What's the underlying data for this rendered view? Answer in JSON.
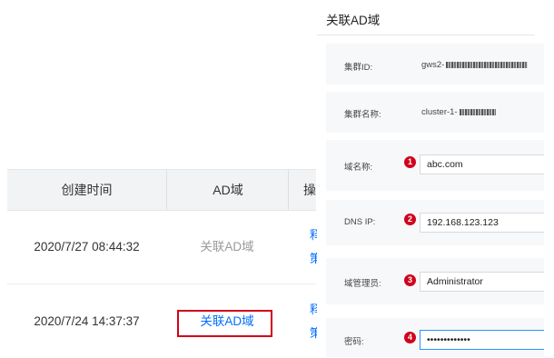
{
  "table": {
    "columns": [
      "创建时间",
      "AD域",
      "操"
    ],
    "rows": [
      {
        "created": "2020/7/27 08:44:32",
        "ad_action": "关联AD域",
        "ad_state": "disabled",
        "op_line1": "释",
        "op_line2": "策"
      },
      {
        "created": "2020/7/24 14:37:37",
        "ad_action": "关联AD域",
        "ad_state": "active",
        "op_line1": "释",
        "op_line2": "策"
      }
    ]
  },
  "modal": {
    "title": "关联AD域",
    "cluster_id": {
      "label": "集群ID:",
      "value_prefix": "gws2-"
    },
    "cluster_name": {
      "label": "集群名称:",
      "value_prefix": "cluster-1-"
    },
    "domain_name": {
      "label": "域名称:",
      "step": "1",
      "value": "abc.com"
    },
    "dns_ip": {
      "label": "DNS IP:",
      "step": "2",
      "value": "192.168.123.123"
    },
    "domain_admin": {
      "label": "域管理员:",
      "step": "3",
      "value": "Administrator"
    },
    "password": {
      "label": "密码:",
      "step": "4",
      "value": "•••••••••••••"
    }
  },
  "colors": {
    "link": "#006eff",
    "disabled": "#9a9a9a",
    "highlight": "#d0021b",
    "focus_border": "#2a93ff"
  }
}
